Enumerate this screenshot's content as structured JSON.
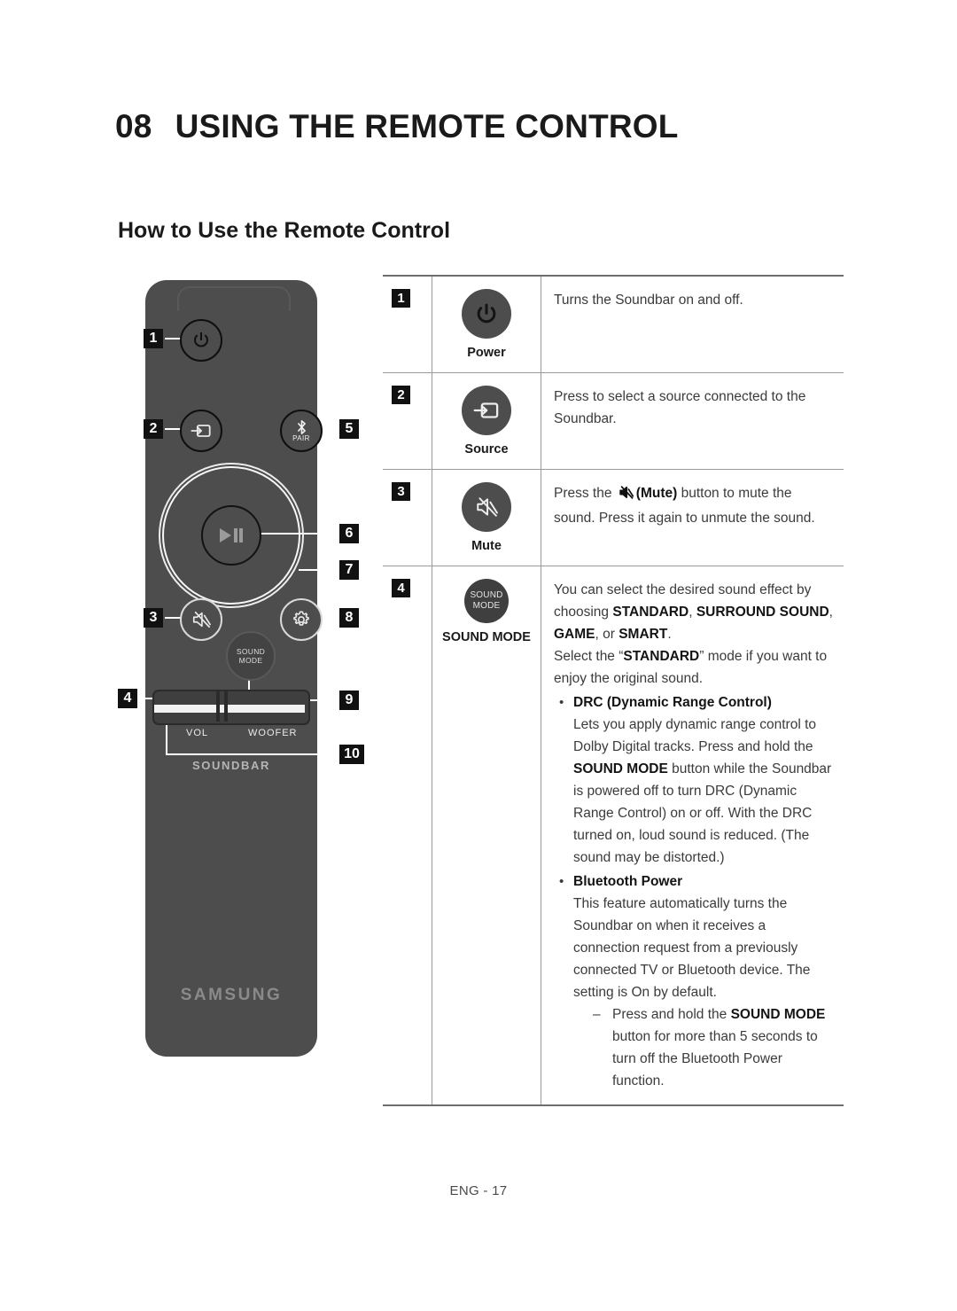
{
  "heading": {
    "chapter_number": "08",
    "chapter_title": "USING THE REMOTE CONTROL",
    "section_title": "How to Use the Remote Control"
  },
  "remote": {
    "sound_mode_line1": "SOUND",
    "sound_mode_line2": "MODE",
    "pair_label": "PAIR",
    "vol_label": "VOL",
    "woofer_label": "WOOFER",
    "soundbar_label": "SOUNDBAR",
    "brand_label": "SAMSUNG",
    "callouts": [
      "1",
      "2",
      "3",
      "4",
      "5",
      "6",
      "7",
      "8",
      "9",
      "10"
    ]
  },
  "table": {
    "rows": [
      {
        "number": "1",
        "caption": "Power",
        "icon": "power-icon",
        "description_plain": "Turns the Soundbar on and off."
      },
      {
        "number": "2",
        "caption": "Source",
        "icon": "source-input-icon",
        "description_plain": "Press to select a source connected to the Soundbar."
      },
      {
        "number": "3",
        "caption": "Mute",
        "icon": "mute-icon",
        "description_part1": "Press the ",
        "description_part2": "(Mute)",
        "description_part3": " button to mute the sound. Press it again to unmute the sound."
      },
      {
        "number": "4",
        "caption": "SOUND MODE",
        "icon": "sound-mode-icon",
        "icon_line1": "SOUND",
        "icon_line2": "MODE",
        "p1_a": "You can select the desired sound effect by choosing ",
        "p1_b1": "STANDARD",
        "p1_c1": ", ",
        "p1_b2": "SURROUND SOUND",
        "p1_c2": ", ",
        "p1_b3": "GAME",
        "p1_c3": ", or ",
        "p1_b4": "SMART",
        "p1_c4": ".",
        "p2_a": "Select the “",
        "p2_b": "STANDARD",
        "p2_c": "” mode if you want to enjoy the original sound.",
        "bullet1_title": "DRC (Dynamic Range Control)",
        "bullet1_a": "Lets you apply dynamic range control to Dolby Digital tracks. Press and hold the ",
        "bullet1_b": "SOUND MODE",
        "bullet1_c": " button while the Soundbar is powered off to turn DRC (Dynamic Range Control) on or off. With the DRC turned on, loud sound is reduced. (The sound may be distorted.)",
        "bullet2_title": "Bluetooth Power",
        "bullet2_a": "This feature automatically turns the Soundbar on when it receives a connection request from a previously connected TV or Bluetooth device. The setting is On by default.",
        "sub_a": "Press and hold the ",
        "sub_b": "SOUND MODE",
        "sub_c": " button for more than 5 seconds to turn off the Bluetooth Power function."
      }
    ]
  },
  "footer": {
    "page_label": "ENG - 17"
  }
}
